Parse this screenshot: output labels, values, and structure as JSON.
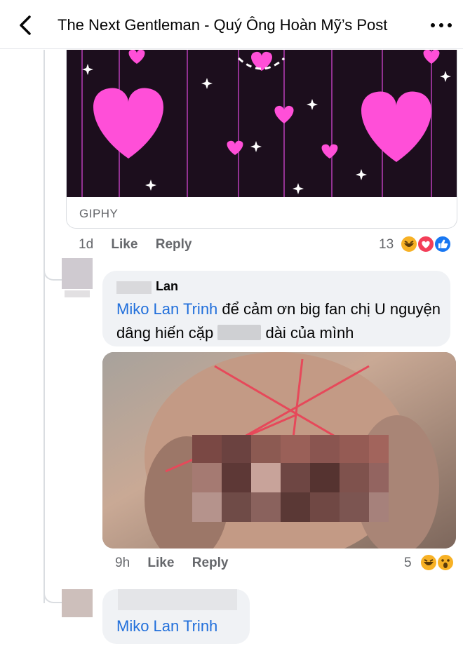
{
  "header": {
    "title": "The Next Gentleman - Quý Ông Hoàn Mỹ’s Post",
    "back_icon": "chevron-left-icon",
    "more_icon": "more-dots-icon"
  },
  "gif": {
    "source_label": "GIPHY",
    "time": "1d",
    "like_label": "Like",
    "reply_label": "Reply",
    "reaction_count": "13",
    "reactions": [
      "haha",
      "love",
      "like"
    ]
  },
  "comment1": {
    "author": "Lan",
    "mention": "Miko Lan Trinh",
    "text_part1": " để cảm ơn big fan chị U nguyện dâng hiến cặp ",
    "text_part2": " dài của mình",
    "time": "9h",
    "like_label": "Like",
    "reply_label": "Reply",
    "reaction_count": "5",
    "reactions": [
      "haha",
      "wow"
    ]
  },
  "comment2": {
    "mention": "Miko Lan Trinh"
  },
  "colors": {
    "mention": "#216fdb",
    "meta_text": "#65676b",
    "bubble_bg": "#f0f2f5",
    "like_blue": "#1877f2",
    "love_red": "#f33e58",
    "haha_yellow": "#f7b125"
  }
}
